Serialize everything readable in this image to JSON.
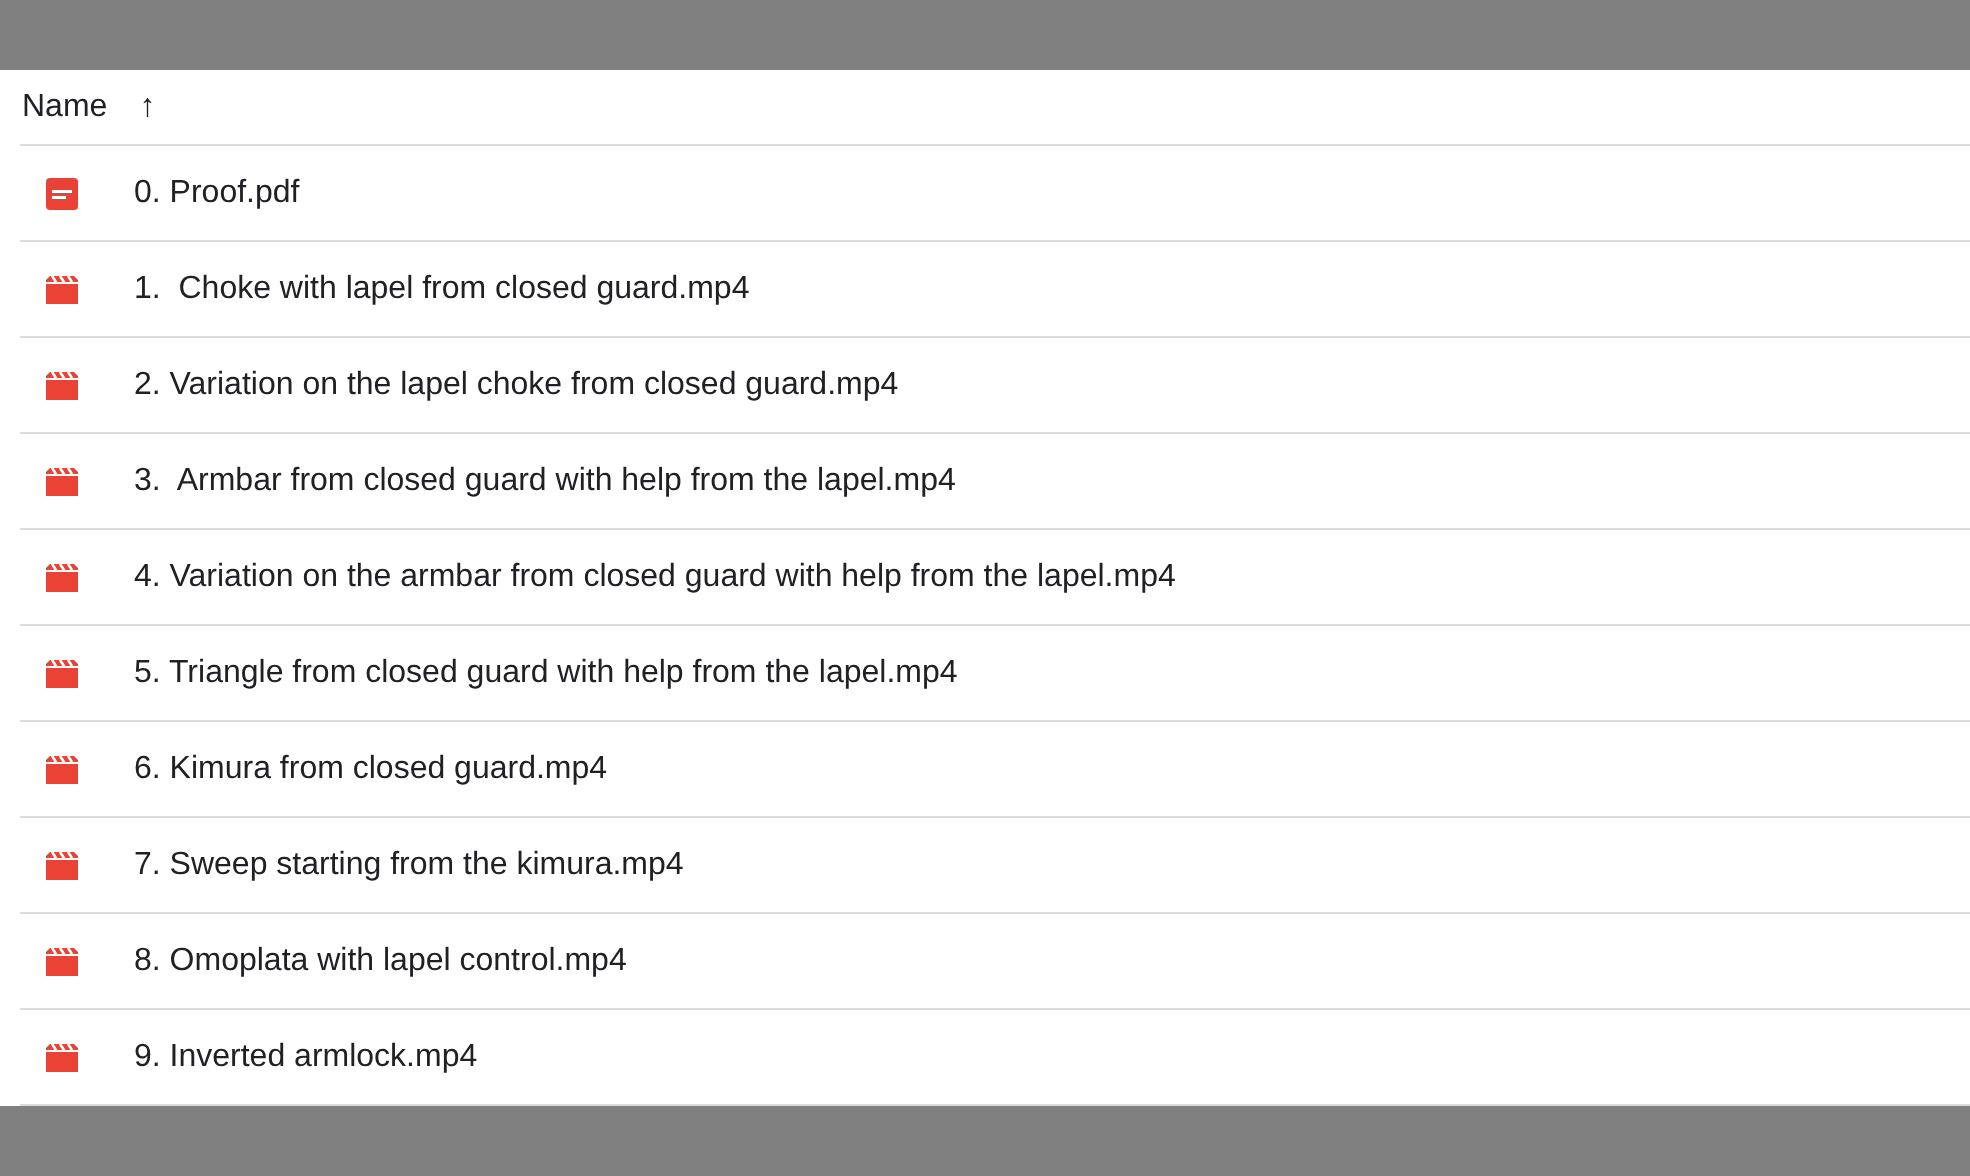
{
  "header": {
    "name_column": "Name",
    "sort_arrow": "↑"
  },
  "files": [
    {
      "kind": "pdf",
      "name": "0. Proof.pdf"
    },
    {
      "kind": "video",
      "name": "1.  Choke with lapel from closed guard.mp4"
    },
    {
      "kind": "video",
      "name": "2. Variation on the lapel choke from closed guard.mp4"
    },
    {
      "kind": "video",
      "name": "3.  Armbar from closed guard with help from the lapel.mp4"
    },
    {
      "kind": "video",
      "name": "4. Variation on the armbar from closed guard with help from the lapel.mp4"
    },
    {
      "kind": "video",
      "name": "5. Triangle from closed guard with help from the lapel.mp4"
    },
    {
      "kind": "video",
      "name": "6. Kimura from closed guard.mp4"
    },
    {
      "kind": "video",
      "name": "7. Sweep starting from the kimura.mp4"
    },
    {
      "kind": "video",
      "name": "8. Omoplata with lapel control.mp4"
    },
    {
      "kind": "video",
      "name": "9. Inverted armlock.mp4"
    }
  ]
}
